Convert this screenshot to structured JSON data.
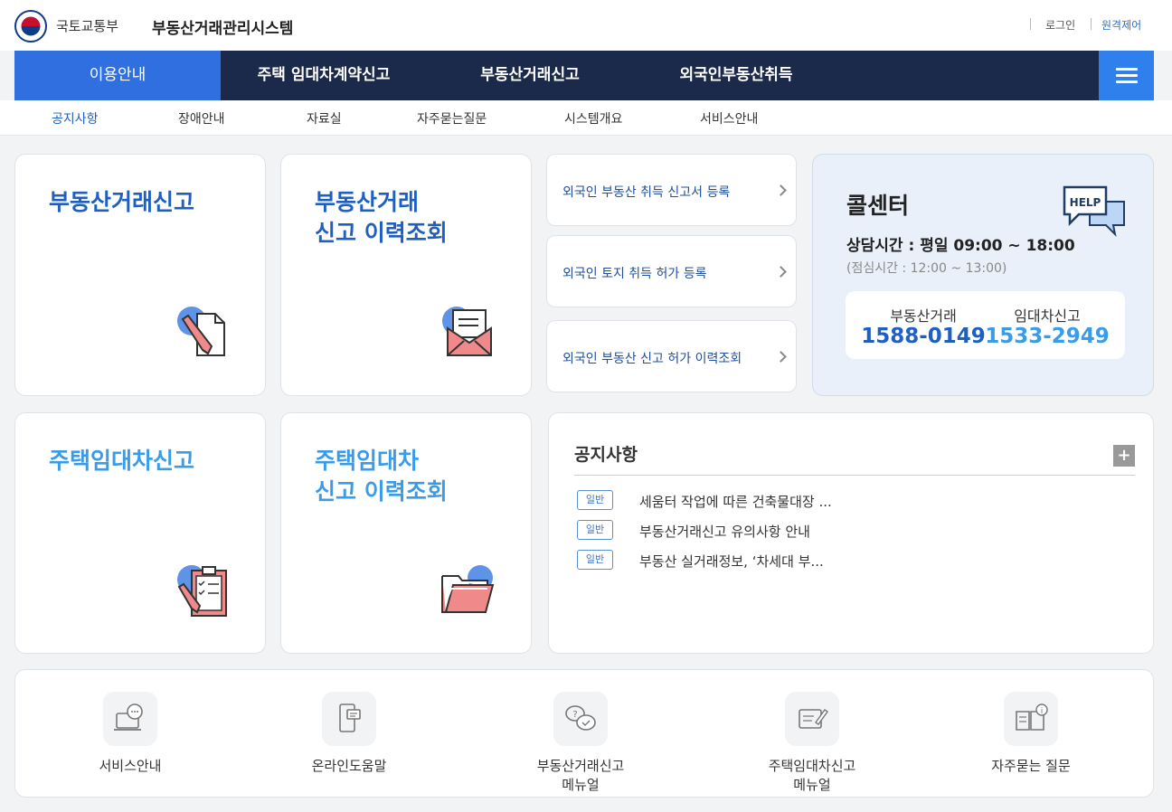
{
  "header": {
    "ministry": "국토교통부",
    "system_title": "부동산거래관리시스템",
    "login": "로그인",
    "remote": "원격제어"
  },
  "gnb": {
    "items": [
      "이용안내",
      "주택 임대차계약신고",
      "부동산거래신고",
      "외국인부동산취득"
    ],
    "active_index": 0
  },
  "lnb": {
    "items": [
      "공지사항",
      "장애안내",
      "자료실",
      "자주묻는질문",
      "시스템개요",
      "서비스안내"
    ],
    "active_index": 0
  },
  "cards": {
    "trade_report": {
      "title": "부동산거래신고"
    },
    "trade_history": {
      "line1": "부동산거래",
      "line2": "신고 이력조회"
    },
    "lease_report": {
      "title": "주택임대차신고"
    },
    "lease_history": {
      "line1": "주택임대차",
      "line2": "신고 이력조회"
    }
  },
  "foreign_links": [
    "외국인 부동산 취득 신고서 등록",
    "외국인 토지 취득 허가 등록",
    "외국인 부동산 신고 허가 이력조회"
  ],
  "callcenter": {
    "title": "콜센터",
    "help_badge": "HELP",
    "hours": "상담시간 : 평일 09:00 ~ 18:00",
    "lunch": "(점심시간 : 12:00 ~ 13:00)",
    "trade_label": "부동산거래",
    "trade_number": "1588-0149",
    "lease_label": "임대차신고",
    "lease_number": "1533-2949"
  },
  "notice": {
    "title": "공지사항",
    "more": "+",
    "items": [
      {
        "badge": "일반",
        "text": "세움터 작업에 따른 건축물대장 ..."
      },
      {
        "badge": "일반",
        "text": "부동산거래신고 유의사항 안내"
      },
      {
        "badge": "일반",
        "text": "부동산 실거래정보, ‘차세대 부..."
      }
    ]
  },
  "quick": [
    {
      "line1": "서비스안내",
      "line2": "",
      "icon": "laptop-chat-icon"
    },
    {
      "line1": "온라인도움말",
      "line2": "",
      "icon": "mobile-chat-icon"
    },
    {
      "line1": "부동산거래신고",
      "line2": "메뉴얼",
      "icon": "faq-bubbles-icon"
    },
    {
      "line1": "주택임대차신고",
      "line2": "메뉴얼",
      "icon": "document-pen-icon"
    },
    {
      "line1": "자주묻는 질문",
      "line2": "",
      "icon": "book-info-icon"
    }
  ],
  "colors": {
    "navy": "#1b2a4a",
    "active_blue": "#2f6fe0",
    "title_blue": "#1f5fbf",
    "title_sky": "#3a9be6"
  }
}
